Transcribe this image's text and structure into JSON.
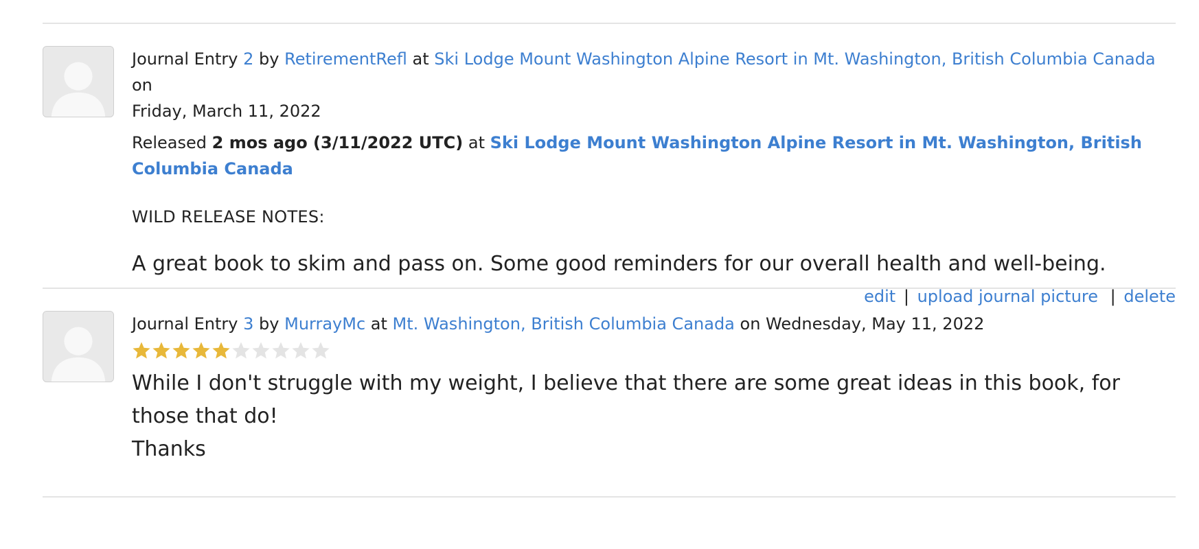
{
  "entries": [
    {
      "prefix": "Journal Entry ",
      "number": "2",
      "by": " by ",
      "user": "RetirementRefl",
      "at": " at ",
      "location": "Ski Lodge Mount Washington Alpine Resort in Mt. Washington, British Columbia Canada",
      "on": " on",
      "date": "Friday, March 11, 2022",
      "released_label": "Released ",
      "released_when": "2 mos ago (3/11/2022 UTC)",
      "released_at": " at ",
      "released_location": "Ski Lodge Mount Washington Alpine Resort in Mt. Washington, British Columbia Canada",
      "notes_label": "WILD RELEASE NOTES:",
      "text": "A great book to skim and pass on. Some good reminders for our overall health and well-being.",
      "actions": {
        "edit": "edit",
        "sep1": "|",
        "upload": "upload journal picture",
        "sep2": "|",
        "delete": "delete"
      }
    },
    {
      "prefix": "Journal Entry ",
      "number": "3",
      "by": " by ",
      "user": "MurrayMc",
      "at": " at ",
      "location": "Mt. Washington, British Columbia Canada",
      "on_date": " on Wednesday, May 11, 2022",
      "rating": 5,
      "rating_max": 10,
      "text_line1": "While I don't struggle with my weight, I believe that there are some great ideas in this book, for those that do!",
      "text_line2": "Thanks"
    }
  ],
  "colors": {
    "link": "#3d7fd0",
    "star_filled": "#e8b83a",
    "star_empty": "#e4e4e4",
    "divider": "#e4e4e4",
    "avatar_bg": "#e9e9e9"
  },
  "icons": {
    "avatar": "default-user-avatar-icon",
    "star": "star-icon"
  }
}
